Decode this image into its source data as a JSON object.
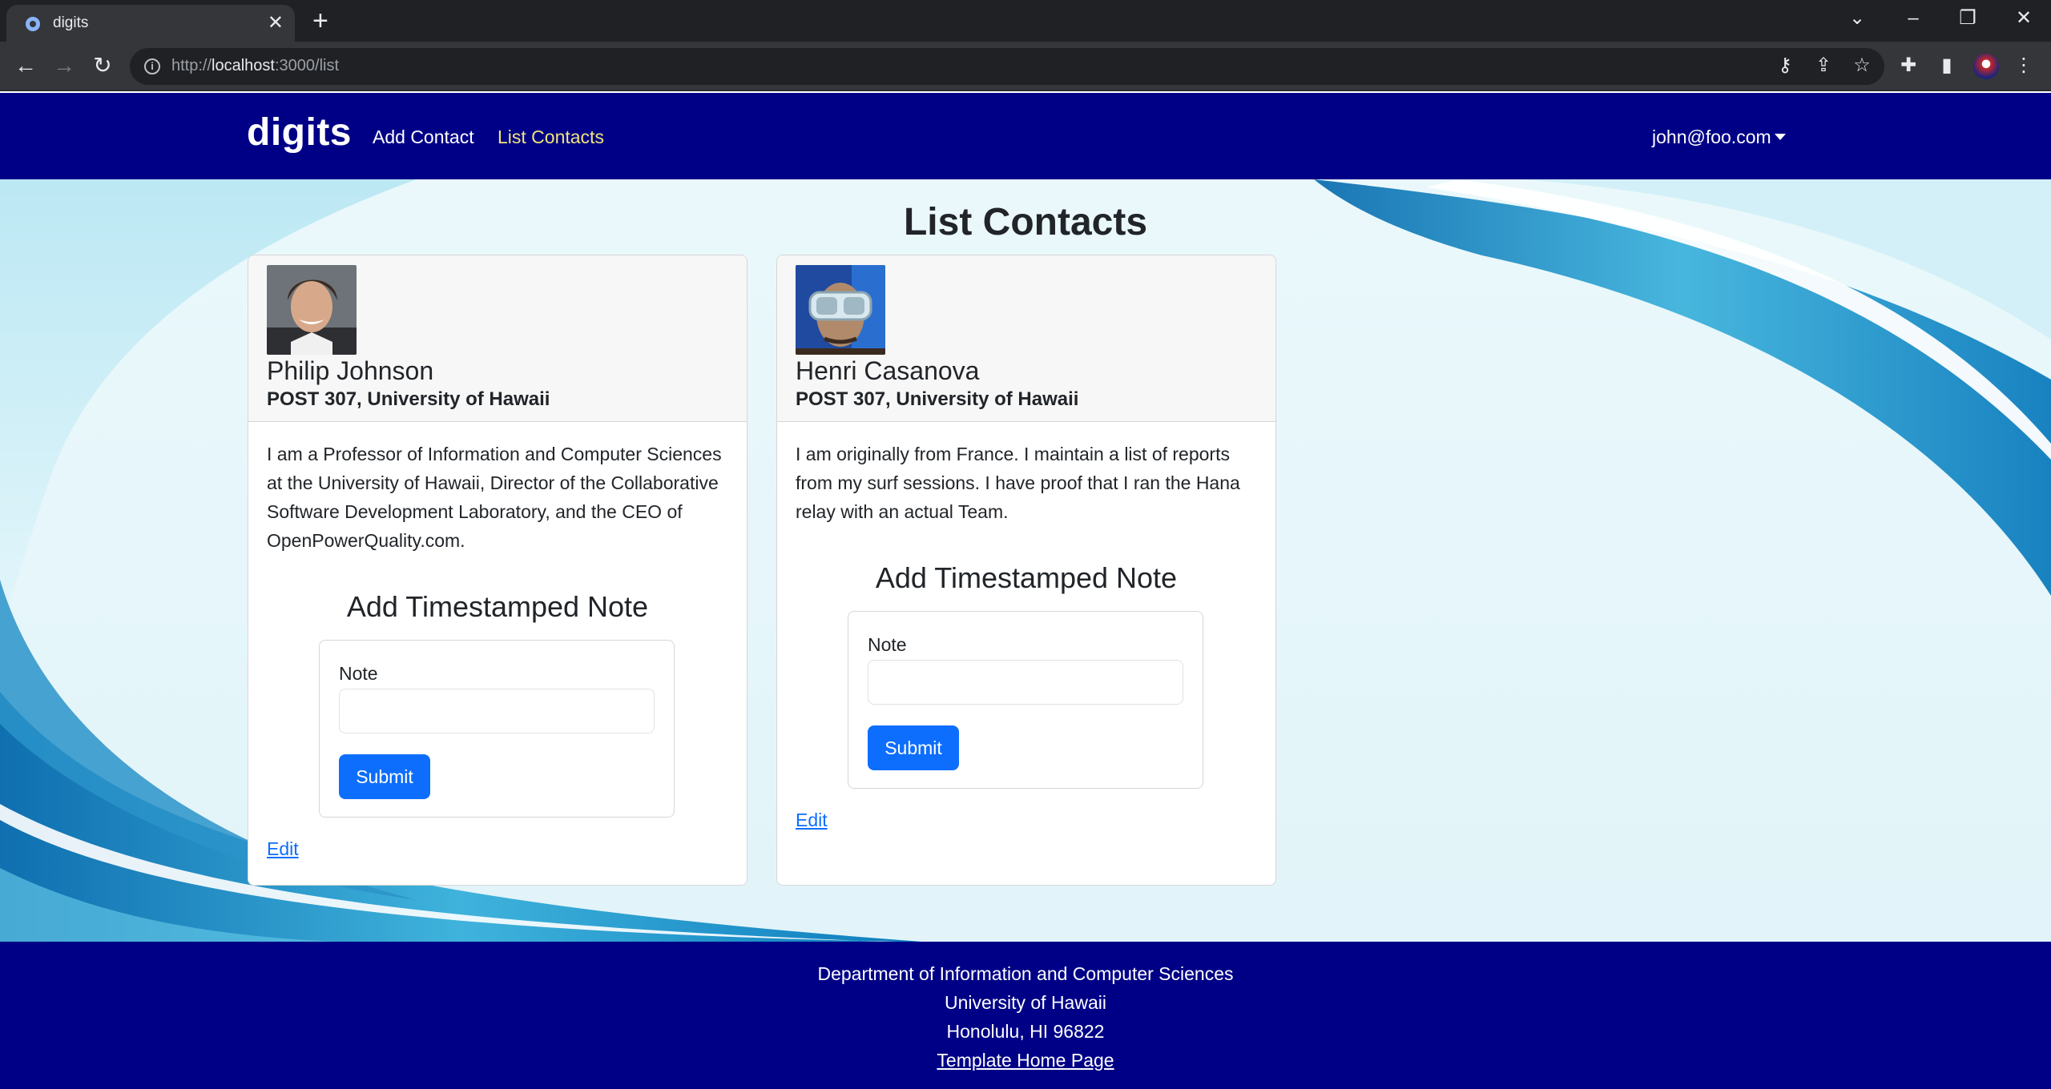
{
  "browser": {
    "tab_title": "digits",
    "url_scheme": "http://",
    "url_host": "localhost",
    "url_path": ":3000/list"
  },
  "navbar": {
    "brand": "digits",
    "links": [
      {
        "label": "Add Contact"
      },
      {
        "label": "List Contacts"
      }
    ],
    "user": "john@foo.com"
  },
  "main": {
    "heading": "List Contacts",
    "contacts": [
      {
        "name": "Philip Johnson",
        "address": "POST 307, University of Hawaii",
        "description": "I am a Professor of Information and Computer Sciences at the University of Hawaii, Director of the Collaborative Software Development Laboratory, and the CEO of OpenPowerQuality.com.",
        "note_form": {
          "title": "Add Timestamped Note",
          "label": "Note",
          "value": "",
          "submit": "Submit"
        },
        "edit": "Edit"
      },
      {
        "name": "Henri Casanova",
        "address": "POST 307, University of Hawaii",
        "description": "I am originally from France. I maintain a list of reports from my surf sessions. I have proof that I ran the Hana relay with an actual Team.",
        "note_form": {
          "title": "Add Timestamped Note",
          "label": "Note",
          "value": "",
          "submit": "Submit"
        },
        "edit": "Edit"
      }
    ]
  },
  "footer": {
    "line1": "Department of Information and Computer Sciences",
    "line2": "University of Hawaii",
    "line3": "Honolulu, HI 96822",
    "link": "Template Home Page"
  },
  "colors": {
    "navbar": "#000087",
    "active_link": "#f2e47a",
    "primary": "#0d6efd"
  }
}
